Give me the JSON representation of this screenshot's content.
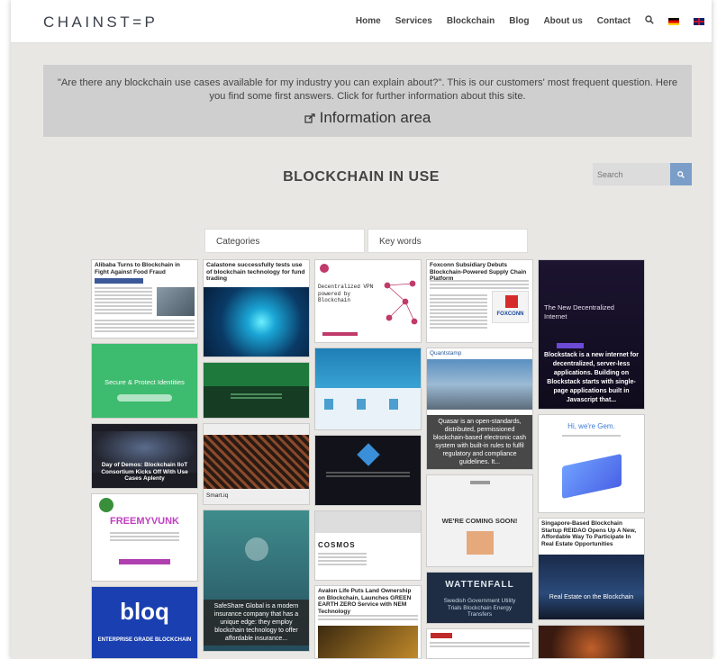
{
  "header": {
    "logo": "CHAINST=P",
    "nav": [
      "Home",
      "Services",
      "Blockchain",
      "Blog",
      "About us",
      "Contact"
    ]
  },
  "info": {
    "text": "\"Are there any blockchain use cases available for my industry you can explain about?\". This is our customers' most frequent question. Here you find some first answers. Click for further information about this site.",
    "link": "Information area"
  },
  "section_title": "BLOCKCHAIN IN USE",
  "search": {
    "placeholder": "Search"
  },
  "filters": {
    "categories": "Categories",
    "keywords": "Key words"
  },
  "cards": {
    "alibaba": "Alibaba Turns to Blockchain in Fight Against Food Fraud",
    "calastone": "Calastone successfully tests use of blockchain technology for fund trading",
    "vpn": "Decentralized VPN powered by Blockchain",
    "foxconn": "Foxconn Subsidiary Debuts Blockchain-Powered Supply Chain Platform",
    "foxconn_logo": "FOXCONN",
    "blockstack_hero": "The New Decentralized Internet",
    "blockstack_caption": "Blockstack is a new internet for decentralized, server-less applications. Building on Blockstack starts with single-page applications built in Javascript that...",
    "civic_hero": "Secure & Protect Identities",
    "quantstamp": "Quantstamp",
    "quasar_caption": "Quasar is an open-standards, distributed, permissioned blockchain-based electronic cash system with built-in rules to fulfil regulatory and compliance guidelines. It...",
    "gem_hero": "Hi, we're Gem.",
    "iiot": "Day of Demos: Blockchain IIoT Consortium Kicks Off With Use Cases Aplenty",
    "smartiq": "Smart.iq",
    "freemyvunk": "FREEMYVUNK",
    "coming_soon": "WE'RE COMING SOON!",
    "singapore": "Singapore-Based Blockchain Startup REIDAO Opens Up A New, Affordable Way To Participate In Real Estate Opportunities",
    "singapore_hero": "Real Estate on the Blockchain",
    "cosmos": "COSMOS",
    "safeshare_caption": "SafeShare Global is a modern insurance company that has a unique edge: they employ blockchain technology to offer affordable insurance...",
    "bloq": "bloq",
    "bloq_sub": "ENTERPRISE GRADE BLOCKCHAIN",
    "avalon": "Avalon Life Puts Land Ownership on Blockchain, Launches GREEN EARTH ZERO Service with NEM Technology",
    "wattenfall": "WATTENFALL",
    "wattenfall_sub": "Swedish Government Utility Trials Blockchain Energy Transfers"
  }
}
